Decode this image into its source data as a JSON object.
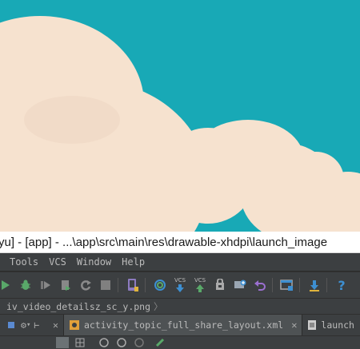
{
  "window": {
    "title": "yu] - [app] - ...\\app\\src\\main\\res\\drawable-xhdpi\\launch_image"
  },
  "menu": {
    "items": [
      {
        "label": "Tools",
        "mnemonic": "T"
      },
      {
        "label": "VCS",
        "mnemonic": "C"
      },
      {
        "label": "Window",
        "mnemonic": "W"
      },
      {
        "label": "Help",
        "mnemonic": "H"
      }
    ]
  },
  "toolbar": {
    "vcs_update_label": "VCS",
    "vcs_commit_label": "VCS",
    "icons": [
      "run-icon",
      "debug-icon",
      "attach-debugger-icon",
      "coverage-icon",
      "rerun-icon",
      "stop-icon",
      "avd-manager-icon",
      "sync-gradle-icon",
      "vcs-update-icon",
      "vcs-commit-icon",
      "vcs-history-icon",
      "vcs-compare-icon",
      "undo-revert-icon",
      "project-structure-icon",
      "sdk-manager-icon",
      "help-icon"
    ]
  },
  "breadcrumb": {
    "file": "iv_video_detailsz_sc_y.png"
  },
  "editor_tabs": [
    {
      "label": "activity_topic_full_share_layout.xml",
      "active": true
    },
    {
      "label": "launch",
      "active": false
    }
  ],
  "colors": {
    "sky": "#18a9b6",
    "cloud": "#f6e2cf",
    "ide_bg": "#3c3f41",
    "accent_blue": "#3d8fd1",
    "accent_green": "#59a869"
  }
}
